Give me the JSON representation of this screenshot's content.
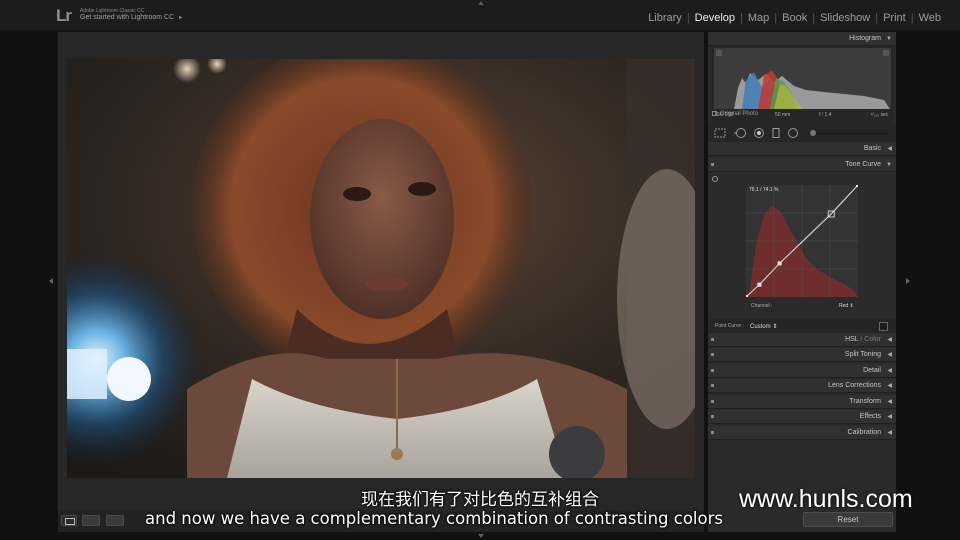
{
  "app": {
    "logo": "Lr",
    "product": "Adobe Lightroom Classic CC",
    "get_started": "Get started with Lightroom CC",
    "get_started_arrow": "▸"
  },
  "modules": [
    {
      "label": "Library",
      "active": false
    },
    {
      "label": "Develop",
      "active": true
    },
    {
      "label": "Map",
      "active": false
    },
    {
      "label": "Book",
      "active": false
    },
    {
      "label": "Slideshow",
      "active": false
    },
    {
      "label": "Print",
      "active": false
    },
    {
      "label": "Web",
      "active": false
    }
  ],
  "panels": {
    "histogram": {
      "title": "Histogram",
      "iso": "ISO 250",
      "focal": "50 mm",
      "aperture": "f / 1.4",
      "shutter": "¹⁄₁₂₅ sec",
      "original_photo": "Original Photo"
    },
    "basic": "Basic",
    "tone_curve": {
      "title": "Tone Curve",
      "readout": "76.1 / 74.1 %",
      "channel_label": "Channel :",
      "channel_value": "Red ⇕",
      "point_curve_label": "Point Curve :",
      "point_curve_value": "Custom ⇕",
      "curve_points": [
        [
          0,
          0
        ],
        [
          12,
          11
        ],
        [
          30,
          30
        ],
        [
          76.1,
          74.1
        ],
        [
          100,
          100
        ]
      ]
    },
    "hsl_a": "HSL",
    "hsl_b": " / Color",
    "split_toning": "Split Toning",
    "detail": "Detail",
    "lens_corrections": "Lens Corrections",
    "transform": "Transform",
    "effects": "Effects",
    "calibration": "Calibration"
  },
  "icons": {
    "collapse": "▼",
    "expand": "◀"
  },
  "buttons": {
    "reset": "Reset"
  },
  "subtitles": {
    "cn": "现在我们有了对比色的互补组合",
    "en": "and now we have a complementary combination of contrasting colors"
  },
  "watermark": "www.hunls.com",
  "colors": {
    "accent_red_histogram": "#7a2d2d",
    "panel_bg": "#2a2a2a",
    "active_module": "#ececec"
  }
}
